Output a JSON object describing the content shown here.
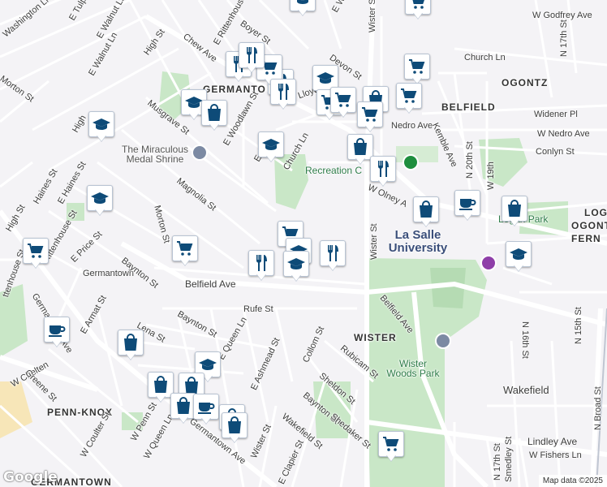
{
  "map": {
    "attribution": "Map data ©2025",
    "logo": "Google",
    "colors": {
      "park": "#c9e7c7",
      "road": "#ffffff",
      "water": "#aadaff",
      "pin_icon": "#0e4b78",
      "bg": "#f4f3f6"
    }
  },
  "labels": {
    "washington_ln": "Washington Ln",
    "e_tulpehocken": "E Tulpehock",
    "e_walnut_ln": "E Walnut Ln",
    "e_walnut_ln2": "E Walnut Ln",
    "morton_st_nw": "Morton St",
    "high_st_n": "High St",
    "chew_ave": "Chew Ave",
    "e_rittenhouse_st_n": "E Rittenhouse St",
    "boyer_st": "Boyer St",
    "germantown_n": "GERMANTO",
    "devon_st": "Devon St",
    "lloyd_st": "Lloyd St",
    "wister_st_n": "Wister St",
    "e_wo": "E Wo",
    "w_godfrey_ave": "W Godfrey Ave",
    "n_17th_st_ne": "N 17th St",
    "church_ln_ne": "Church Ln",
    "ogontz": "OGONTZ",
    "belfield_area": "BELFIELD",
    "widener_pl": "Widener Pl",
    "nedro_ave": "Nedro Ave",
    "w_nedro_ave": "W Nedro Ave",
    "conlyn_st": "Conlyn St",
    "kemble_ave": "Kemble Ave",
    "musgrave_st": "Musgrave St",
    "e_woodlawn_st": "E Woodlawn St",
    "e_l_ave": "E L",
    "church_ln": "Church Ln",
    "high_st_w": "High",
    "e_haines_st": "E Haines St",
    "miraculous": "The Miraculous Medal Shrine",
    "recreation": "Recreation C",
    "w_olney_ave": "W Olney A",
    "n_20th_st": "N 20th St",
    "w_19th": "W 19th",
    "logan_park": "Logan Park",
    "logan": "LOG",
    "ogontz_2": "OGONTZ",
    "fern": "FERN",
    "magnolia_st": "Magnolia St",
    "morton_st": "Morton St",
    "wister_st": "Wister St",
    "e_haines_left": "Haines St",
    "high_st_sw": "High St",
    "rittenhouse_st": "Rittenhouse St",
    "e_price_st": "E Price St",
    "germantown_station": "Germantown",
    "baynton_st": "Baynton St",
    "belfield_ave": "Belfield Ave",
    "belfield_ave_e": "Belfield Ave",
    "la_salle": "La Salle University",
    "rufe_st": "Rufe St",
    "baynton_st_2": "Baynton St",
    "lena_st": "Lena St",
    "e_queen_ln": "E Queen Ln",
    "e_armat_st": "E Armat St",
    "germantown_ave_w": "Germantown Ave",
    "w_chelten": "W Chelten",
    "greene_st": "Greene St",
    "wister_area": "WISTER",
    "collom_st": "Collom St",
    "e_ashmead_st": "E Ashmead St",
    "rubicam_st": "Rubicam St",
    "wister_woods_park": "Wister Woods Park",
    "n_16th_st": "N 16th St",
    "n_15th_st": "N 15th St",
    "wakefield": "Wakefield",
    "sheldon_st": "Sheldon St",
    "baynton_st_3": "Baynton St",
    "shedaker_st": "Shedaker St",
    "wakefield_st": "Wakefield St",
    "penn_knox": "PENN-KNOX",
    "w_penn_st": "W Penn St",
    "w_queen_ln": "W Queen Ln",
    "w_coulter_st": "W Coulter St",
    "germantown_ave": "Germantown Ave",
    "wister_st_s": "Wister St",
    "e_clapier_st": "E Clapier St",
    "lindley_ave": "Lindley Ave",
    "w_fishers_ln": "W Fishers Ln",
    "n_17th_st_s": "N 17th St",
    "smedley_st": "Smedley St",
    "n_broad_st": "N Broad St",
    "germantown_s": "GERMANTOWN",
    "e_s": "E S",
    "ackenhouse": "ttenhouse St"
  },
  "pins": [
    {
      "icon": "graduation-cap",
      "id": "p1"
    },
    {
      "icon": "shopping-cart",
      "id": "p2"
    },
    {
      "icon": "graduation-cap",
      "id": "p3"
    },
    {
      "icon": "fork-knife",
      "id": "p4"
    },
    {
      "icon": "fork-knife",
      "id": "p5"
    },
    {
      "icon": "shopping-cart",
      "id": "p6"
    },
    {
      "icon": "shopping-cart",
      "id": "p7"
    },
    {
      "icon": "fork-knife",
      "id": "p8"
    },
    {
      "icon": "fork-knife",
      "id": "p9"
    },
    {
      "icon": "graduation-cap",
      "id": "p10"
    },
    {
      "icon": "shopping-cart",
      "id": "p11"
    },
    {
      "icon": "shopping-cart",
      "id": "p12"
    },
    {
      "icon": "shopping-bag",
      "id": "p13"
    },
    {
      "icon": "shopping-cart",
      "id": "p14"
    },
    {
      "icon": "shopping-cart",
      "id": "p15"
    },
    {
      "icon": "graduation-cap",
      "id": "p16"
    },
    {
      "icon": "shopping-bag",
      "id": "p17"
    },
    {
      "icon": "graduation-cap",
      "id": "p18"
    },
    {
      "icon": "graduation-cap",
      "id": "p19"
    },
    {
      "icon": "shopping-bag",
      "id": "p20"
    },
    {
      "icon": "fork-knife",
      "id": "p21"
    },
    {
      "icon": "shopping-cart",
      "id": "p22"
    },
    {
      "icon": "shopping-bag",
      "id": "p23"
    },
    {
      "icon": "coffee-cup",
      "id": "p24"
    },
    {
      "icon": "shopping-bag",
      "id": "p25"
    },
    {
      "icon": "shopping-cart",
      "id": "p26"
    },
    {
      "icon": "graduation-cap",
      "id": "p27"
    },
    {
      "icon": "shopping-cart",
      "id": "p28"
    },
    {
      "icon": "graduation-cap",
      "id": "p29"
    },
    {
      "icon": "fork-knife",
      "id": "p30"
    },
    {
      "icon": "fork-knife",
      "id": "p31"
    },
    {
      "icon": "graduation-cap",
      "id": "p32"
    },
    {
      "icon": "coffee-cup",
      "id": "p33"
    },
    {
      "icon": "shopping-bag",
      "id": "p34"
    },
    {
      "icon": "graduation-cap",
      "id": "p35"
    },
    {
      "icon": "shopping-bag",
      "id": "p36"
    },
    {
      "icon": "shopping-bag",
      "id": "p37"
    },
    {
      "icon": "shopping-bag",
      "id": "p38"
    },
    {
      "icon": "coffee-cup",
      "id": "p39"
    },
    {
      "icon": "shopping-bag",
      "id": "p40"
    },
    {
      "icon": "shopping-cart",
      "id": "p41"
    },
    {
      "icon": "shopping-bag",
      "id": "p42"
    }
  ]
}
